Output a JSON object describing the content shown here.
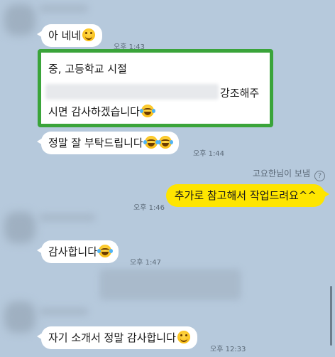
{
  "messages": [
    {
      "text": "아 네네",
      "time": "오후 1:43"
    },
    {
      "line1": "중, 고등학교 시절",
      "line2_tail": "강조해주",
      "line3": "시면 감사하겠습니다"
    },
    {
      "text": "정말 잘 부탁드립니다",
      "time": "오후 1:44"
    },
    {
      "sender_note": "고요한님이 보냄",
      "text": "추가로 참고해서 작업드려요^^",
      "time": "오후 1:46"
    },
    {
      "text": "감사합니다",
      "time": "오후 1:47"
    },
    {
      "text": "자기 소개서 정말 감사합니다",
      "time": "오후 12:33"
    }
  ],
  "icons": {
    "help": "question-icon",
    "smile": "smiling-face-emoji",
    "laugh": "tears-of-joy-emoji"
  },
  "colors": {
    "background": "#b9cde0",
    "my_bubble": "#fee500",
    "their_bubble": "#ffffff",
    "highlight_border": "#3aa43a"
  }
}
